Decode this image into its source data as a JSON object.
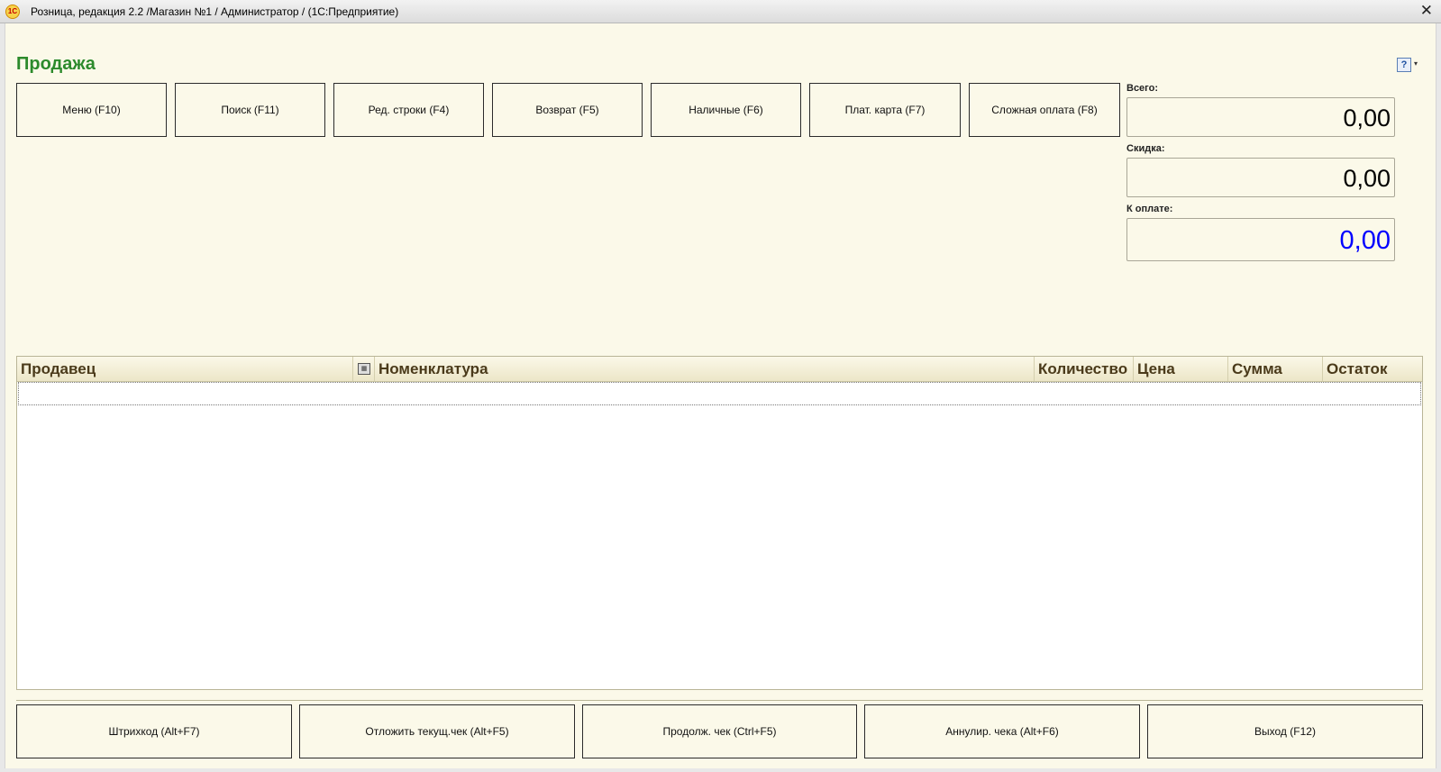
{
  "window": {
    "title": "Розница, редакция 2.2 /Магазин №1 / Администратор /  (1С:Предприятие)",
    "logo_text": "1С",
    "close_glyph": "✕"
  },
  "form": {
    "title": "Продажа",
    "help_glyph": "?",
    "help_arrow": "▾"
  },
  "top_buttons": [
    {
      "label": "Меню (F10)"
    },
    {
      "label": "Поиск (F11)"
    },
    {
      "label": "Ред. строки (F4)"
    },
    {
      "label": "Возврат (F5)"
    },
    {
      "label": "Наличные (F6)"
    },
    {
      "label": "Плат. карта (F7)"
    },
    {
      "label": "Сложная оплата (F8)"
    }
  ],
  "totals": {
    "total_label": "Всего:",
    "total_value": "0,00",
    "discount_label": "Скидка:",
    "discount_value": "0,00",
    "pay_label": "К оплате:",
    "pay_value": "0,00",
    "pay_color": "#0000ff"
  },
  "table": {
    "columns": [
      "Продавец",
      "Номенклатура",
      "Количество",
      "Цена",
      "Сумма",
      "Остаток"
    ],
    "rows": []
  },
  "bottom_buttons": [
    {
      "label": "Штрихкод (Alt+F7)"
    },
    {
      "label": "Отложить текущ.чек (Alt+F5)"
    },
    {
      "label": "Продолж. чек (Ctrl+F5)"
    },
    {
      "label": "Аннулир. чека (Alt+F6)"
    },
    {
      "label": "Выход (F12)"
    }
  ]
}
